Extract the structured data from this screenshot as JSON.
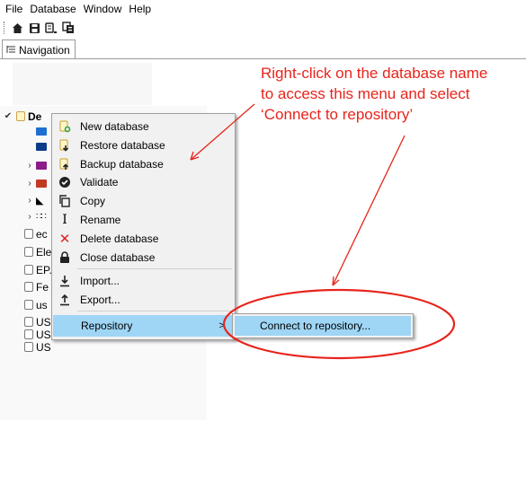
{
  "menubar": [
    "File",
    "Database",
    "Window",
    "Help"
  ],
  "toolbar": {
    "icons": [
      "home-icon",
      "save-icon",
      "database-icon",
      "copy-icon"
    ]
  },
  "tab": {
    "label": "Navigation",
    "icon": "navigation-tree-icon"
  },
  "tree": {
    "first": "De",
    "items": [
      "ec",
      "Ele",
      "EP.",
      "Fe",
      "us",
      "US",
      "US",
      "US"
    ]
  },
  "context_menu": {
    "items": [
      {
        "label": "New database",
        "icon": "new-database-icon"
      },
      {
        "label": "Restore database",
        "icon": "restore-database-icon"
      },
      {
        "label": "Backup database",
        "icon": "backup-database-icon"
      },
      {
        "label": "Validate",
        "icon": "validate-icon"
      },
      {
        "label": "Copy",
        "icon": "copy-icon"
      },
      {
        "label": "Rename",
        "icon": "rename-icon"
      },
      {
        "label": "Delete database",
        "icon": "delete-icon"
      },
      {
        "label": "Close database",
        "icon": "lock-icon"
      },
      {
        "label": "Import...",
        "icon": "import-icon"
      },
      {
        "label": "Export...",
        "icon": "export-icon"
      },
      {
        "label": "Repository",
        "icon": ""
      }
    ],
    "submenu_arrow": ">"
  },
  "submenu": {
    "item": "Connect to repository..."
  },
  "annotation": {
    "line1": "Right-click on the database name",
    "line2": "to access this menu and select",
    "line3": "‘Connect to repository’",
    "color": "#e8241c"
  },
  "colors": {
    "highlight": "#9fd5f5",
    "menu_bg": "#f1f1f1"
  }
}
